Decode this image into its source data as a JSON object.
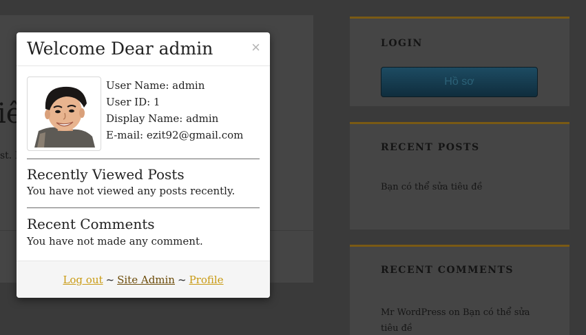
{
  "background": {
    "heading_fragment": "iê",
    "text_fragment": "st. I",
    "widgets": {
      "login": {
        "title": "LOGIN",
        "button_label": "Hồ sơ"
      },
      "recent_posts": {
        "title": "RECENT POSTS",
        "item": "Bạn có thể sửa tiêu đề"
      },
      "recent_comments": {
        "title": "RECENT COMMENTS",
        "item": "Mr WordPress on Bạn có thể sửa tiêu đề"
      }
    }
  },
  "modal": {
    "title": "Welcome Dear admin",
    "close_label": "×",
    "avatar_icon": "user-avatar-icon",
    "user": {
      "user_name": "User Name: admin",
      "user_id": "User ID: 1",
      "display_name": "Display Name: admin",
      "email": "E-mail: ezit92@gmail.com"
    },
    "recently_viewed": {
      "title": "Recently Viewed Posts",
      "text": "You have not viewed any posts recently."
    },
    "recent_comments": {
      "title": "Recent Comments",
      "text": "You have not made any comment."
    },
    "footer": {
      "logout": "Log out",
      "site_admin": "Site Admin",
      "profile": "Profile",
      "separator": "~"
    }
  },
  "colors": {
    "overlay_bg": "#3a3a3a",
    "widget_accent": "#7a5a14",
    "link_gold": "#c99a12",
    "link_dark": "#6b4a08"
  }
}
